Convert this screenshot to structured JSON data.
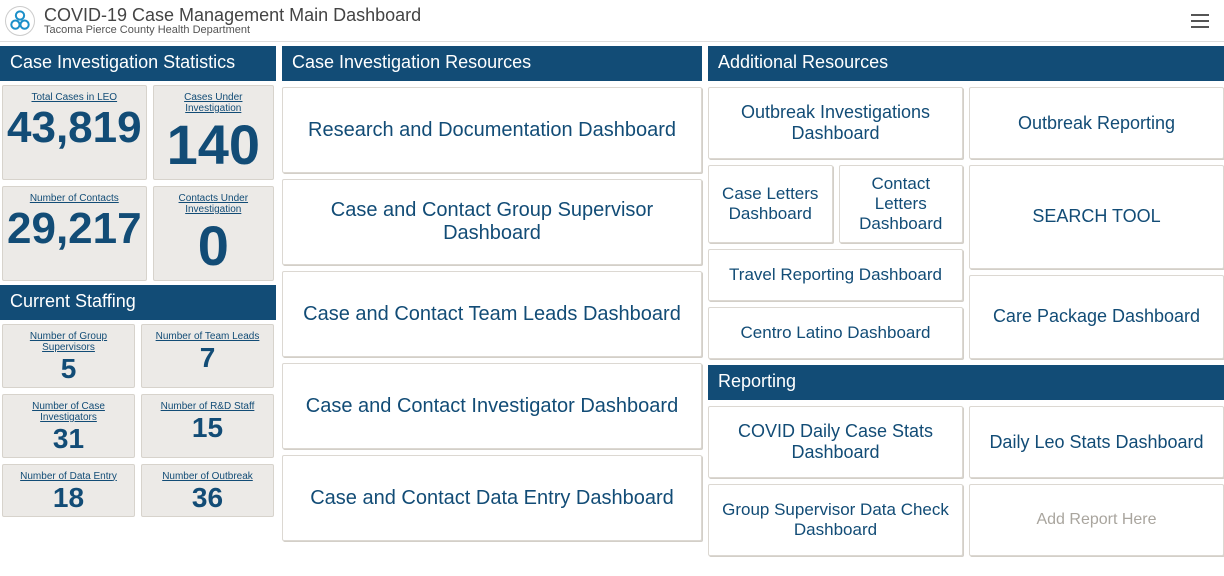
{
  "header": {
    "app_title": "COVID-19 Case Management Main Dashboard",
    "subtitle": "Tacoma Pierce County Health Department"
  },
  "left": {
    "statistics_title": "Case Investigation Statistics",
    "stats": [
      {
        "label": "Total Cases in LEO",
        "value": "43,819"
      },
      {
        "label": "Cases Under Investigation",
        "value": "140"
      },
      {
        "label": "Number of Contacts",
        "value": "29,217"
      },
      {
        "label": "Contacts Under Investigation",
        "value": "0"
      }
    ],
    "staffing_title": "Current Staffing",
    "staffing": [
      {
        "label": "Number of  Group Supervisors",
        "value": "5"
      },
      {
        "label": "Number of Team Leads",
        "value": "7"
      },
      {
        "label": "Number of Case Investigators",
        "value": "31"
      },
      {
        "label": "Number of R&D Staff",
        "value": "15"
      },
      {
        "label": "Number of Data Entry",
        "value": "18"
      },
      {
        "label": "Number of Outbreak",
        "value": "36"
      }
    ]
  },
  "mid": {
    "title": "Case Investigation Resources",
    "tiles": [
      "Research and Documentation Dashboard",
      "Case and Contact Group Supervisor Dashboard",
      "Case and Contact Team Leads Dashboard",
      "Case and Contact Investigator Dashboard",
      "Case and Contact Data Entry Dashboard"
    ]
  },
  "right": {
    "additional_title": "Additional Resources",
    "outbreak_investigations": "Outbreak Investigations Dashboard",
    "outbreak_reporting": "Outbreak Reporting",
    "case_letters": "Case Letters Dashboard",
    "contact_letters": "Contact Letters Dashboard",
    "search_tool": "SEARCH TOOL",
    "travel_reporting": "Travel Reporting Dashboard",
    "centro_latino": "Centro Latino Dashboard",
    "care_package": "Care Package Dashboard",
    "reporting_title": "Reporting",
    "reporting_tiles": {
      "covid_daily": "COVID Daily Case Stats Dashboard",
      "daily_leo": "Daily Leo Stats Dashboard",
      "group_supervisor": "Group Supervisor Data Check Dashboard",
      "add_report": "Add Report Here"
    }
  }
}
